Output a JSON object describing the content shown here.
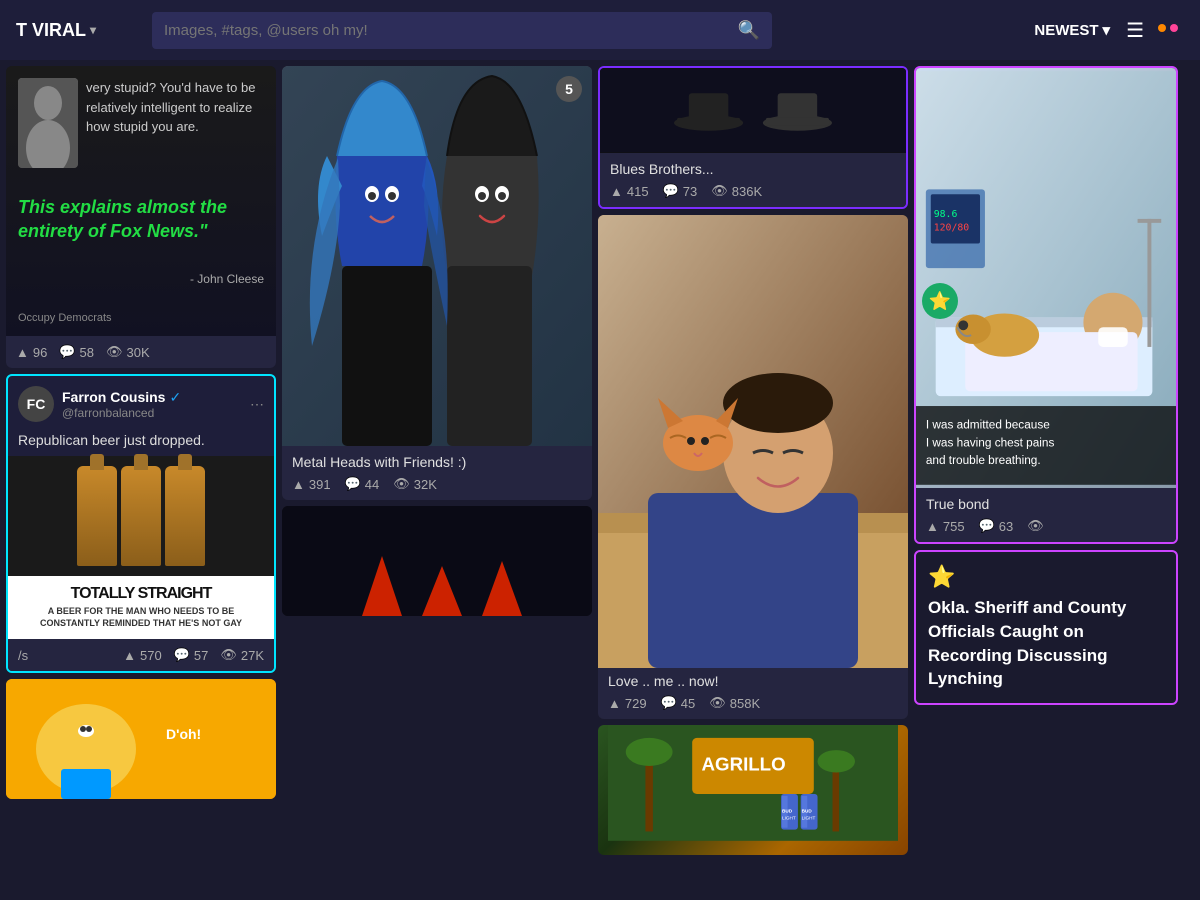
{
  "header": {
    "logo": "T VIRAL",
    "search_placeholder": "Images, #tags, @users oh my!",
    "sort_label": "NEWEST",
    "chevron": "▾",
    "menu_icon": "≡"
  },
  "cards": {
    "quote": {
      "top_text": "very stupid? You'd have to be relatively intelligent to realize how stupid you are.",
      "italic_text": "This explains almost the entirety of Fox News.\"",
      "author": "- John Cleese",
      "source": "Occupy Democrats",
      "stats": {
        "likes": "96",
        "comments": "58",
        "views": "30K"
      }
    },
    "tweet": {
      "user": "Farron Cousins",
      "handle": "@farronbalanced",
      "verified": true,
      "body": "Republican beer just dropped.",
      "beer_title": "TOTALLY STRAIGHT",
      "beer_tagline": "A BEER FOR THE MAN WHO NEEDS TO BE CONSTANTLY REMINDED THAT HE'S NOT GAY",
      "footer_text": "/s",
      "stats": {
        "likes": "570",
        "comments": "57",
        "views": "27K"
      }
    },
    "metal": {
      "title": "Metal Heads with Friends! :)",
      "image_count": "5",
      "stats": {
        "likes": "391",
        "comments": "44",
        "views": "32K"
      }
    },
    "blues": {
      "title": "Blues Brothers...",
      "stats": {
        "likes": "415",
        "comments": "73",
        "views": "836K"
      }
    },
    "cat": {
      "title": "Love .. me .. now!",
      "stats": {
        "likes": "729",
        "comments": "45",
        "views": "858K"
      }
    },
    "true_bond": {
      "title": "True bond",
      "caption": "I was admitted because I was having chest pains and trouble breathing.",
      "stats": {
        "likes": "755",
        "comments": "63",
        "views": ""
      }
    },
    "sheriff": {
      "star_emoji": "⭐",
      "title": "Okla. Sheriff and County Officials Caught on Recording Discussing Lynching",
      "stats": {
        "likes": "",
        "comments": "",
        "views": ""
      }
    }
  },
  "icons": {
    "upvote": "▲",
    "comment": "💬",
    "views": "👁",
    "search": "🔍",
    "verified": "✓"
  }
}
